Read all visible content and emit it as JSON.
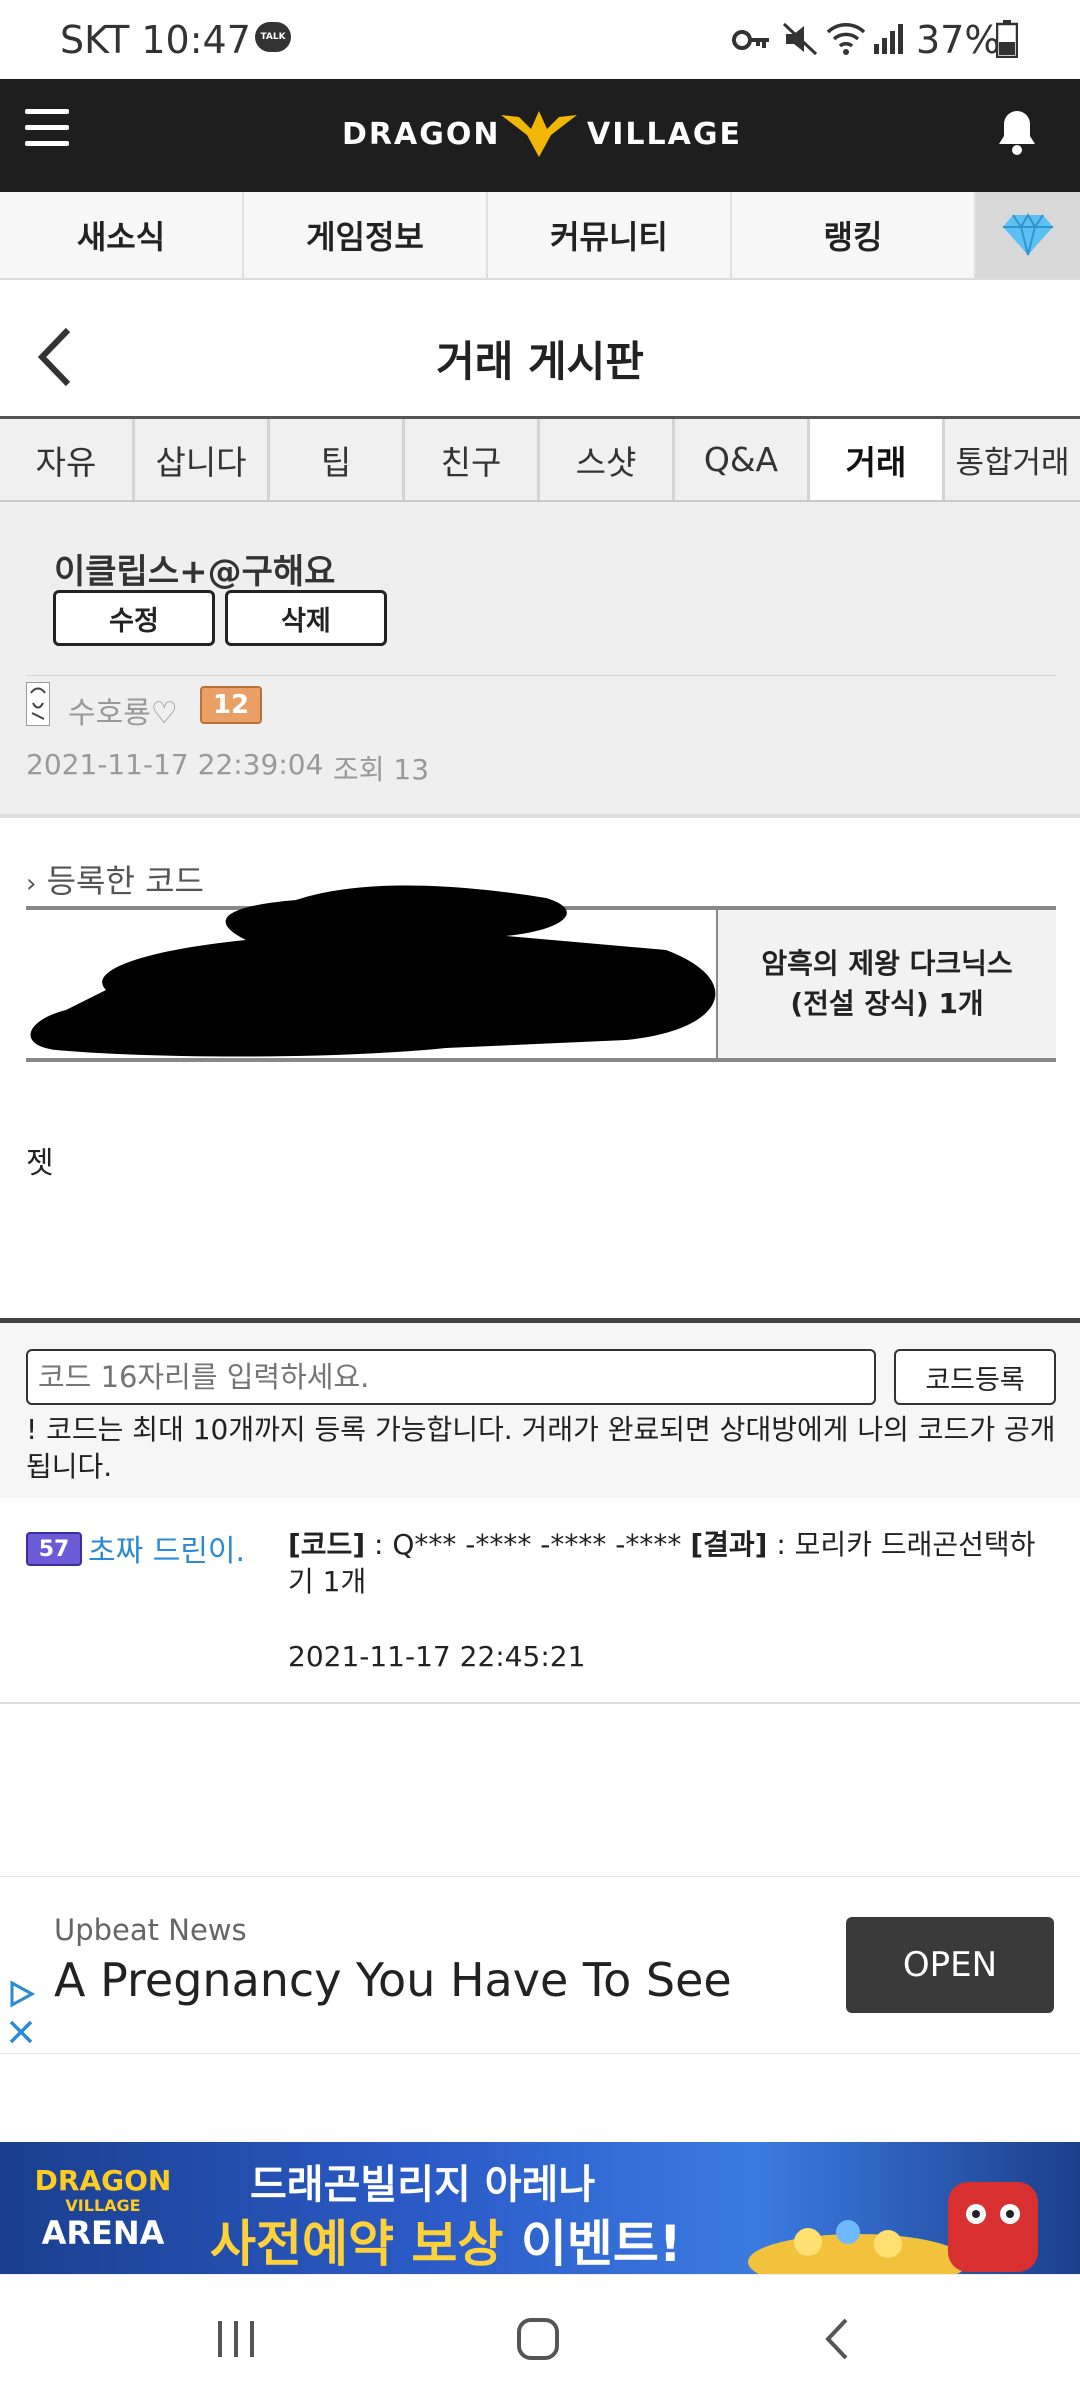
{
  "status_bar": {
    "carrier_time": "SKT 10:47",
    "talk_badge": "TALK",
    "battery": "37%"
  },
  "header": {
    "logo_left": "DRAGON",
    "logo_right": "VILLAGE"
  },
  "main_nav": [
    "새소식",
    "게임정보",
    "커뮤니티",
    "랭킹"
  ],
  "board": {
    "title": "거래 게시판"
  },
  "sub_tabs": [
    "자유",
    "삽니다",
    "팁",
    "친구",
    "스샷",
    "Q&A",
    "거래",
    "통합거래"
  ],
  "post": {
    "title": "이클립스+@구해요",
    "edit_label": "수정",
    "delete_label": "삭제",
    "author": "수호룡♡",
    "author_level": "12",
    "date": "2021-11-17 22:39:04",
    "views": "조회 13"
  },
  "code_section": {
    "label": "등록한 코드",
    "reward_line1": "암흑의 제왕 다크닉스",
    "reward_line2": "(전설 장식) 1개",
    "body": "젯"
  },
  "code_entry": {
    "placeholder": "코드 16자리를 입력하세요.",
    "register_label": "코드등록",
    "notice": "! 코드는 최대 10개까지 등록 가능합니다. 거래가 완료되면 상대방에게 나의 코드가 공개됩니다."
  },
  "log": {
    "level": "57",
    "user": "초짜 드린이.",
    "code_tag": "[코드]",
    "code_value": " : Q*** -**** -**** -**** ",
    "result_tag": "[결과]",
    "result_value": " : 모리카 드래곤선택하기 1개",
    "date": "2021-11-17 22:45:21"
  },
  "ad": {
    "source": "Upbeat News",
    "headline": "A Pregnancy You Have To See",
    "cta": "OPEN"
  },
  "banner": {
    "logo_line1": "DRAGON",
    "logo_line2": "VILLAGE",
    "logo_line3": "ARENA",
    "line1": "드래곤빌리지 아레나",
    "line2a": "사전예약 보상",
    "line2b": "이벤트!"
  },
  "colors": {
    "header_bg": "#1e1e1e",
    "accent_gold": "#f2b705",
    "link_blue": "#2a8ad4",
    "ad_button": "#3a3a3a"
  }
}
